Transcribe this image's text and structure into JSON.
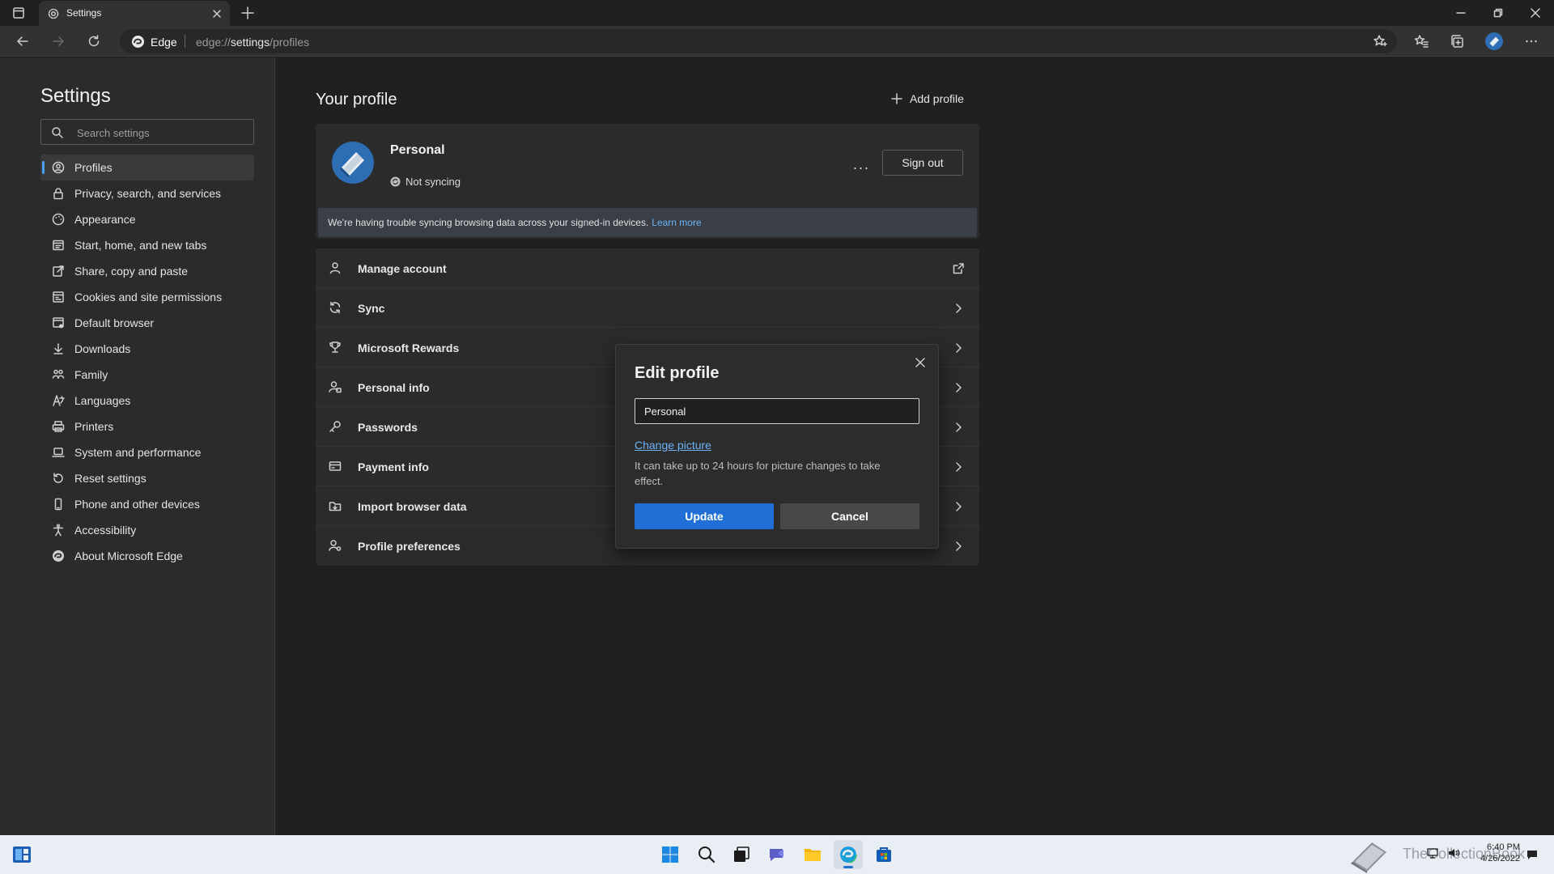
{
  "browser": {
    "tab_title": "Settings",
    "site_name": "Edge",
    "url_prefix": "edge://",
    "url_path": "settings",
    "url_suffix": "/profiles"
  },
  "sidebar": {
    "title": "Settings",
    "search_placeholder": "Search settings",
    "items": [
      {
        "label": "Profiles",
        "icon": "profiles-icon",
        "active": true
      },
      {
        "label": "Privacy, search, and services",
        "icon": "lock-icon"
      },
      {
        "label": "Appearance",
        "icon": "appearance-icon"
      },
      {
        "label": "Start, home, and new tabs",
        "icon": "home-icon"
      },
      {
        "label": "Share, copy and paste",
        "icon": "share-icon"
      },
      {
        "label": "Cookies and site permissions",
        "icon": "cookies-icon"
      },
      {
        "label": "Default browser",
        "icon": "default-browser-icon"
      },
      {
        "label": "Downloads",
        "icon": "download-icon"
      },
      {
        "label": "Family",
        "icon": "family-icon"
      },
      {
        "label": "Languages",
        "icon": "languages-icon"
      },
      {
        "label": "Printers",
        "icon": "printer-icon"
      },
      {
        "label": "System and performance",
        "icon": "laptop-icon"
      },
      {
        "label": "Reset settings",
        "icon": "reset-icon"
      },
      {
        "label": "Phone and other devices",
        "icon": "phone-icon"
      },
      {
        "label": "Accessibility",
        "icon": "accessibility-icon"
      },
      {
        "label": "About Microsoft Edge",
        "icon": "edge-icon"
      }
    ]
  },
  "main": {
    "title": "Your profile",
    "add_profile": "Add profile",
    "profile": {
      "name": "Personal",
      "sync_status": "Not syncing",
      "more": "···",
      "sign_out": "Sign out",
      "banner_text": "We're having trouble syncing browsing data across your signed-in devices.",
      "banner_link": "Learn more"
    },
    "rows": [
      {
        "label": "Manage account",
        "icon": "account-icon",
        "trailing": "external-link-icon"
      },
      {
        "label": "Sync",
        "icon": "sync-icon",
        "trailing": "chevron-right-icon"
      },
      {
        "label": "Microsoft Rewards",
        "icon": "trophy-icon",
        "trailing": "chevron-right-icon"
      },
      {
        "label": "Personal info",
        "icon": "person-info-icon",
        "trailing": "chevron-right-icon"
      },
      {
        "label": "Passwords",
        "icon": "key-icon",
        "trailing": "chevron-right-icon"
      },
      {
        "label": "Payment info",
        "icon": "card-icon",
        "trailing": "chevron-right-icon"
      },
      {
        "label": "Import browser data",
        "icon": "import-icon",
        "trailing": "chevron-right-icon"
      },
      {
        "label": "Profile preferences",
        "icon": "profile-prefs-icon",
        "trailing": "chevron-right-icon"
      }
    ]
  },
  "modal": {
    "title": "Edit profile",
    "name_value": "Personal",
    "change_picture": "Change picture",
    "note": "It can take up to 24 hours for picture changes to take effect.",
    "update": "Update",
    "cancel": "Cancel"
  },
  "taskbar": {
    "watermark": "TheCollectionBook",
    "time": "6:40 PM",
    "date": "4/26/2022"
  },
  "colors": {
    "accent": "#1f6fd6",
    "link": "#6cb3f5",
    "page_bg": "#202020",
    "card_bg": "#2b2b2b"
  }
}
